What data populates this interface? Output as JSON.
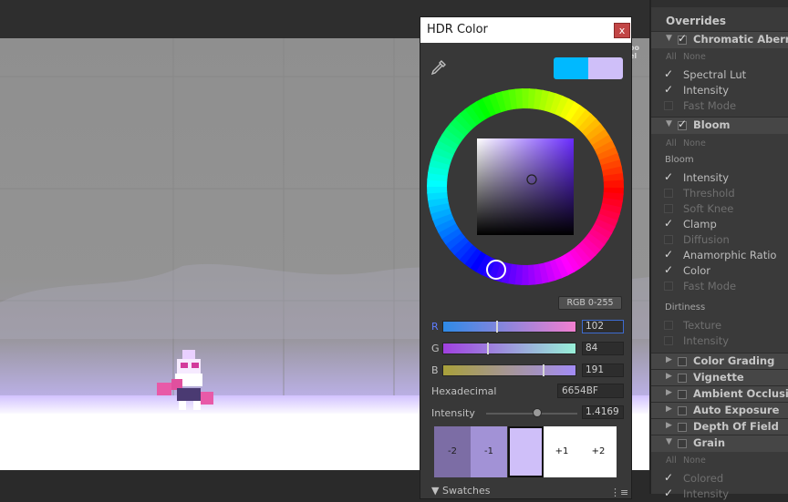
{
  "scene": {
    "hidden_label": "oo el"
  },
  "dialog": {
    "title": "HDR Color",
    "close_label": "x",
    "prev_old_color": "#00b9ff",
    "prev_new_color": "#cfbff9",
    "mode_label": "RGB 0-255",
    "channels": [
      {
        "name": "R",
        "value": "102",
        "level": 0.4,
        "gradient": [
          "#2e8ae6",
          "#f27fd0"
        ]
      },
      {
        "name": "G",
        "value": "84",
        "level": 0.33,
        "gradient": [
          "#a040e0",
          "#98f0d8"
        ]
      },
      {
        "name": "B",
        "value": "191",
        "level": 0.75,
        "gradient": [
          "#a8a03a",
          "#a38cf6"
        ]
      }
    ],
    "hex_label": "Hexadecimal",
    "hex_value": "6654BF",
    "intensity_label": "Intensity",
    "intensity_value": "1.4169",
    "intensity_level": 0.56,
    "exposure": [
      {
        "label": "-2",
        "color": "#7c6da5"
      },
      {
        "label": "-1",
        "color": "#a292d6"
      },
      {
        "label": "",
        "color": "#cfbff9"
      },
      {
        "label": "+1",
        "color": "#ffffff"
      },
      {
        "label": "+2",
        "color": "#ffffff"
      }
    ],
    "swatches_label": "Swatches",
    "swatches_menu": "⋮≡"
  },
  "inspector": {
    "overrides": "Overrides",
    "sections": {
      "chromatic": "Chromatic Aberration",
      "bloom": "Bloom",
      "color_grading": "Color Grading",
      "vignette": "Vignette",
      "ambient": "Ambient Occlusion",
      "auto_exposure": "Auto Exposure",
      "dof": "Depth Of Field",
      "grain": "Grain"
    },
    "all_none": {
      "all": "All",
      "none": "None"
    },
    "chromatic_items": [
      "Spectral Lut",
      "Intensity",
      "Fast Mode"
    ],
    "bloom_group": "Bloom",
    "bloom_items": [
      "Intensity",
      "Threshold",
      "Soft Knee",
      "Clamp",
      "Diffusion",
      "Anamorphic Ratio",
      "Color",
      "Fast Mode"
    ],
    "dirtiness_group": "Dirtiness",
    "dirt_items": [
      "Texture",
      "Intensity"
    ],
    "grain_items": [
      "Colored",
      "Intensity"
    ]
  }
}
